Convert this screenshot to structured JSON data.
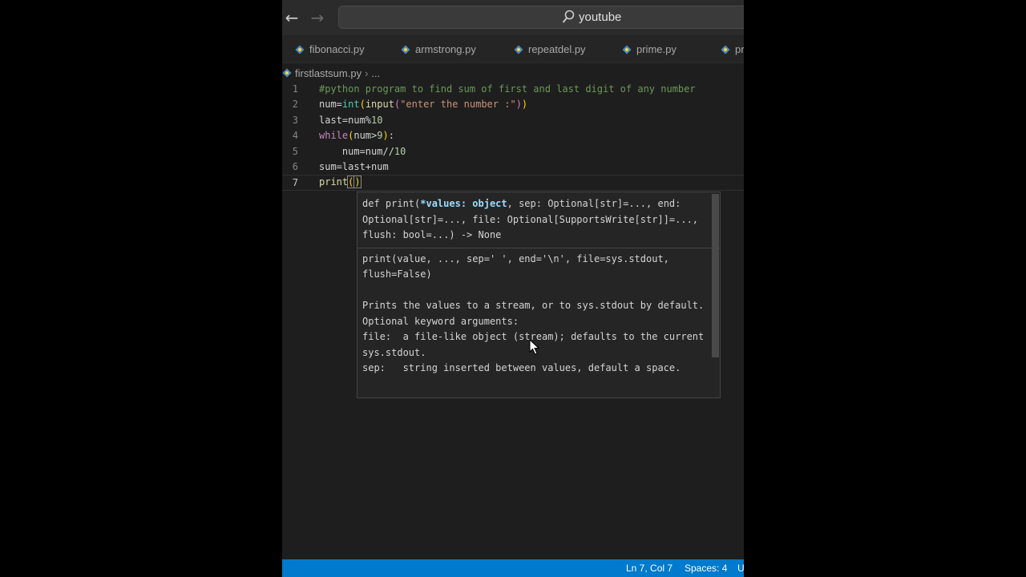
{
  "titlebar": {
    "search_text": "youtube"
  },
  "tabs": [
    {
      "label": "fibonacci.py"
    },
    {
      "label": "armstrong.py"
    },
    {
      "label": "repeatdel.py"
    },
    {
      "label": "prime.py"
    },
    {
      "label": "pr"
    }
  ],
  "breadcrumb": {
    "file": "firstlastsum.py",
    "ellipsis": "..."
  },
  "editor": {
    "line_numbers": [
      "1",
      "2",
      "3",
      "4",
      "5",
      "6",
      "7"
    ],
    "lines": [
      "#python program to find sum of first and last digit of any number",
      "num=int(input(\"enter the number :\"))",
      "last=num%10",
      "while(num>9):",
      "    num=num//10",
      "sum=last+num",
      "print()"
    ]
  },
  "hover": {
    "sig_part1": "def print(",
    "sig_param": "*values: object",
    "sig_part2": ", sep: Optional[str]=..., end: Optional[str]=..., file: Optional[SupportsWrite[str]]=..., flush: bool=...) -> None",
    "doc": "print(value, ..., sep=' ', end='\\n', file=sys.stdout, flush=False)\n\nPrints the values to a stream, or to sys.stdout by default.\nOptional keyword arguments:\nfile:  a file-like object (stream); defaults to the current sys.stdout.\nsep:   string inserted between values, default a space."
  },
  "statusbar": {
    "position": "Ln 7, Col 7",
    "spaces": "Spaces: 4",
    "encoding": "U"
  },
  "colors": {
    "statusbar": "#007acc",
    "editor_bg": "#1e1e1e",
    "comment": "#6a9955",
    "keyword": "#c586c0",
    "function": "#dcdcaa",
    "string": "#ce9178",
    "number": "#b5cea8"
  }
}
